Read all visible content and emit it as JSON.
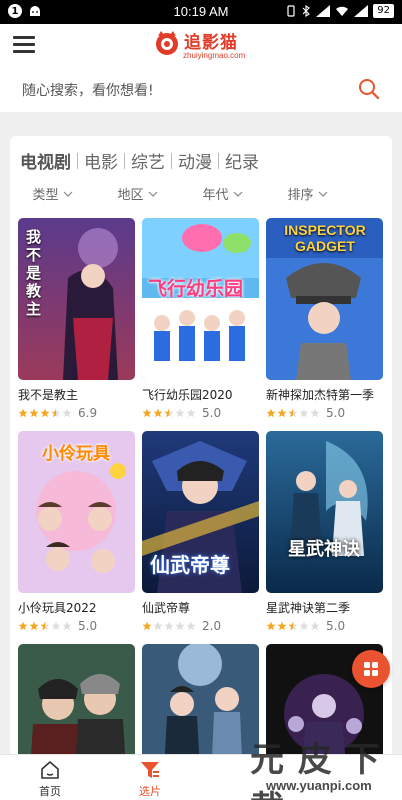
{
  "statusbar": {
    "notif_count": "1",
    "time": "10:19 AM",
    "battery": "92"
  },
  "header": {
    "logo_cn": "追影猫",
    "logo_en": "zhuiyingmao.com"
  },
  "search": {
    "placeholder": "随心搜索，看你想看!"
  },
  "category_tabs": [
    "电视剧",
    "电影",
    "综艺",
    "动漫",
    "纪录"
  ],
  "filters": [
    "类型",
    "地区",
    "年代",
    "排序"
  ],
  "items": [
    {
      "title": "我不是教主",
      "score": "6.9",
      "stars": 3.5,
      "poster_text": "我不是教主"
    },
    {
      "title": "飞行幼乐园2020",
      "score": "5.0",
      "stars": 2.5,
      "poster_text": "飞行幼乐园"
    },
    {
      "title": "新神探加杰特第一季",
      "score": "5.0",
      "stars": 2.5,
      "poster_text": "INSPECTOR GADGET"
    },
    {
      "title": "小伶玩具2022",
      "score": "5.0",
      "stars": 2.5,
      "poster_text": "小伶玩具"
    },
    {
      "title": "仙武帝尊",
      "score": "2.0",
      "stars": 1,
      "poster_text": "仙武帝尊"
    },
    {
      "title": "星武神诀第二季",
      "score": "5.0",
      "stars": 2.5,
      "poster_text": "星武神诀"
    },
    {
      "title": "",
      "score": "",
      "stars": 0,
      "poster_text": ""
    },
    {
      "title": "",
      "score": "",
      "stars": 0,
      "poster_text": ""
    },
    {
      "title": "",
      "score": "",
      "stars": 0,
      "poster_text": ""
    }
  ],
  "bottom_nav": {
    "home": "首页",
    "select": "选片"
  },
  "watermark": {
    "cn": "元 皮 下 载",
    "en": "www.yuanpi.com"
  },
  "colors": {
    "accent": "#e9532f",
    "logo": "#e23b28",
    "star_on": "#f5a623",
    "star_off": "#dddddd"
  }
}
